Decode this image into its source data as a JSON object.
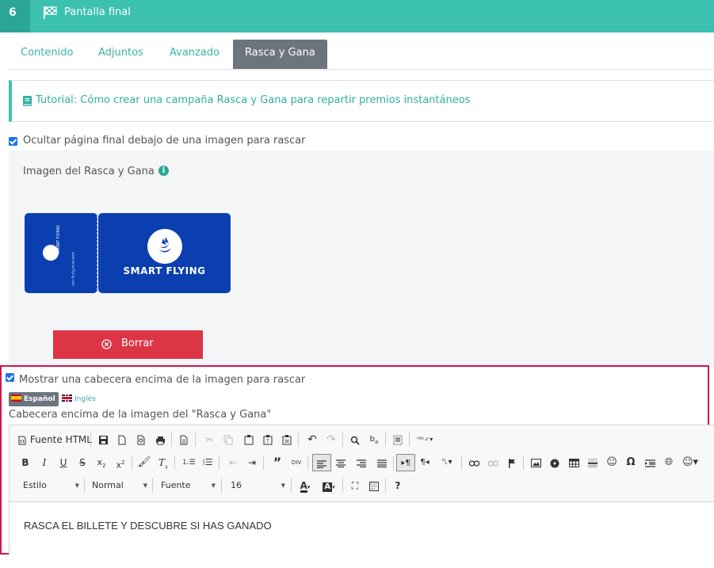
{
  "header": {
    "step_number": "6",
    "title": "Pantalla final",
    "icon": "flag-checkered-icon"
  },
  "tabs": [
    {
      "label": "Contenido",
      "active": false
    },
    {
      "label": "Adjuntos",
      "active": false
    },
    {
      "label": "Avanzado",
      "active": false
    },
    {
      "label": "Rasca y Gana",
      "active": true
    }
  ],
  "tutorial": {
    "icon": "book-icon",
    "link_text": "Tutorial: Cómo crear una campaña Rasca y Gana para repartir premios instantáneos"
  },
  "hide_final_page": {
    "checked": true,
    "label": "Ocultar página final debajo de una imagen para rascar"
  },
  "scratch_image": {
    "title": "Imagen del Rasca y Gana",
    "info_icon": "info-circle-icon",
    "image_text": "SMART FLYING",
    "stub_text": "SMART FLYING",
    "stub_url": "www.smartflying.com",
    "delete_label": "Borrar"
  },
  "show_header": {
    "checked": true,
    "label": "Mostrar una cabecera encima de la imagen para rascar"
  },
  "languages": [
    {
      "label": "Español",
      "active": true
    },
    {
      "label": "Inglés",
      "active": false
    }
  ],
  "header_field_label": "Cabecera encima de la imagen del \"Rasca y Gana\"",
  "editor": {
    "source_label": "Fuente HTML",
    "combos": {
      "style": "Estilo",
      "format": "Normal",
      "font": "Fuente",
      "size": "16"
    },
    "content": "RASCA EL BILLETE Y DESCUBRE SI HAS GANADO"
  },
  "colors": {
    "accent": "#3cc1b0",
    "active_tab": "#6c757d",
    "danger": "#dc3545",
    "highlight_border": "#d0164a",
    "ticket_blue": "#0b3fb0"
  }
}
